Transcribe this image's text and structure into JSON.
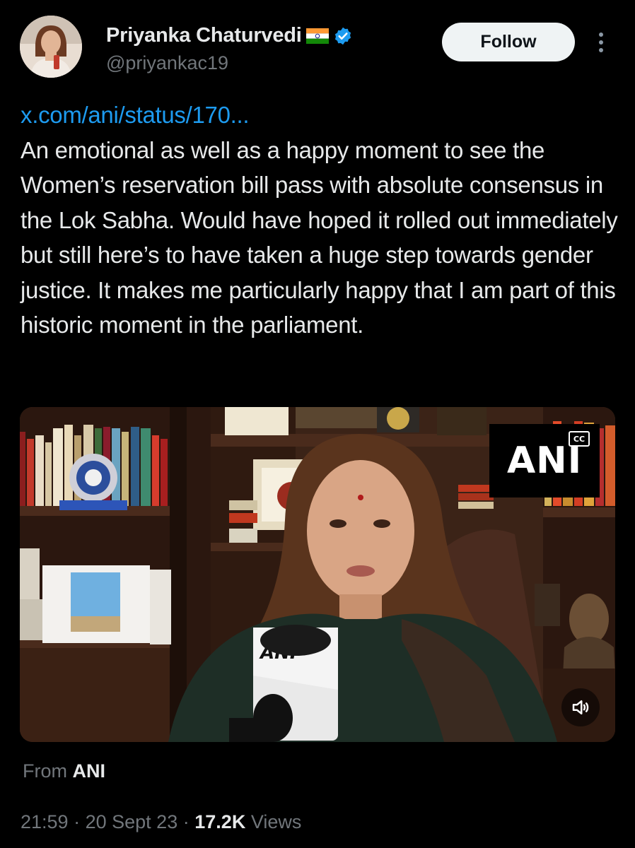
{
  "author": {
    "display_name": "Priyanka Chaturvedi",
    "handle": "@priyankac19",
    "flag_icon": "india-flag-icon",
    "verified_icon": "verified-badge-icon",
    "verified_color": "#1d9bf0"
  },
  "actions": {
    "follow_label": "Follow",
    "more_icon": "more-vertical-icon"
  },
  "tweet": {
    "link_text": "x.com/ani/status/170...",
    "link_color": "#1d9bf0",
    "body": "An emotional as well as a happy moment to see the Women’s reservation bill pass with absolute consensus in the Lok Sabha. Would have hoped it rolled out immediately but still here’s to have taken a huge step towards gender justice. It makes me particularly happy that I am part of this historic moment in the parliament."
  },
  "media": {
    "type": "video",
    "broadcaster_logo": "ANI",
    "cc_label": "CC",
    "mic_label": "ANI",
    "mute_icon": "speaker-muted-icon"
  },
  "source": {
    "prefix": "From",
    "name": "ANI"
  },
  "meta": {
    "time": "21:59",
    "separator": "·",
    "date": "20 Sept 23",
    "views_count": "17.2K",
    "views_label": "Views"
  },
  "colors": {
    "background": "#000000",
    "text_primary": "#e7e9ea",
    "text_secondary": "#71767b",
    "follow_button_bg": "#eff3f4"
  }
}
